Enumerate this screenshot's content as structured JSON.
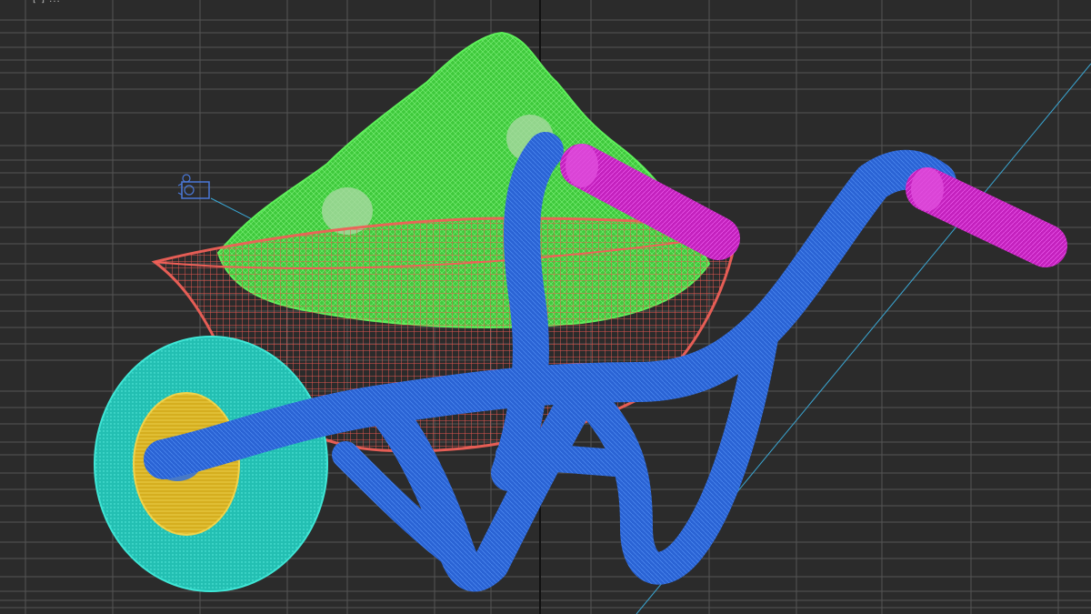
{
  "app": {
    "view_type": "3D viewport (wireframe)",
    "background_color": "#2b2b2b",
    "grid_color": "#555555",
    "grid_major_color": "#777777"
  },
  "overlay": {
    "corner_text": "[ ] ... "
  },
  "scene": {
    "objects": [
      {
        "name": "sand-pile",
        "color": "#4ed94a"
      },
      {
        "name": "tray",
        "color": "#e0544d"
      },
      {
        "name": "frame",
        "color": "#2f6ee0"
      },
      {
        "name": "handle-grips",
        "color": "#d82ad0"
      },
      {
        "name": "wheel-tire",
        "color": "#28d1c2"
      },
      {
        "name": "wheel-hub",
        "color": "#e6c22a"
      }
    ],
    "camera_icon": "camera-icon",
    "guide_line_color": "#3aa7d4"
  }
}
